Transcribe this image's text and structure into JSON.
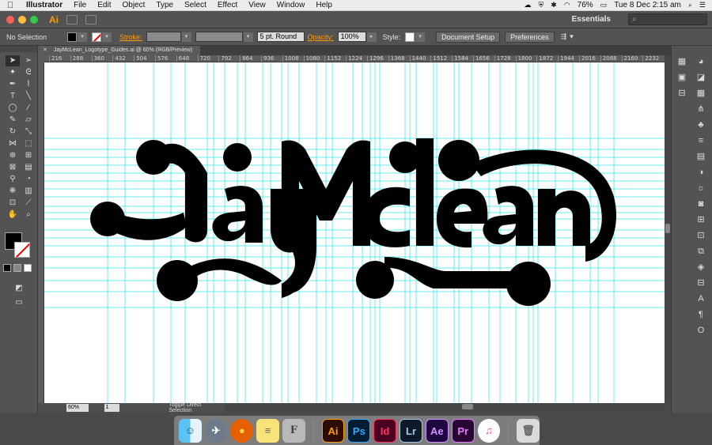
{
  "menubar": {
    "app_name": "Illustrator",
    "items": [
      "File",
      "Edit",
      "Object",
      "Type",
      "Select",
      "Effect",
      "View",
      "Window",
      "Help"
    ],
    "battery": "76%",
    "datetime": "Tue 8 Dec  2:15 am"
  },
  "appbar": {
    "logo": "Ai",
    "workspace": "Essentials"
  },
  "controlbar": {
    "selection": "No Selection",
    "stroke_label": "Stroke:",
    "brush": "5 pt. Round",
    "opacity_label": "Opacity:",
    "opacity_value": "100%",
    "style_label": "Style:",
    "document_setup": "Document Setup",
    "preferences": "Preferences"
  },
  "document": {
    "tab_title": "JayMcLean_Logotype_Guides.ai @ 60% (RGB/Preview)"
  },
  "ruler": {
    "marks": [
      "216",
      "288",
      "360",
      "432",
      "504",
      "576",
      "648",
      "720",
      "792",
      "864",
      "936",
      "1008",
      "1080",
      "1152",
      "1224",
      "1296",
      "1368",
      "1440",
      "1512",
      "1584",
      "1656",
      "1728",
      "1800",
      "1872",
      "1944",
      "2016",
      "2088",
      "2160",
      "2232"
    ]
  },
  "artwork": {
    "text": "JayMcLean",
    "fill": "#000000",
    "guide_color": "#34e3e8"
  },
  "statusbar": {
    "zoom": "60%",
    "page": "1",
    "status": "Toggle Direct Selection"
  },
  "dock": {
    "apps": [
      {
        "name": "Finder",
        "glyph": "☺",
        "cls": "finder"
      },
      {
        "name": "Launchpad",
        "glyph": "✈",
        "cls": "launch"
      },
      {
        "name": "Firefox",
        "glyph": "●",
        "cls": "firefox"
      },
      {
        "name": "Notes",
        "glyph": "≡",
        "cls": "notes"
      },
      {
        "name": "Font Book",
        "glyph": "F",
        "cls": "font"
      },
      {
        "name": "Illustrator",
        "glyph": "Ai",
        "cls": "ai"
      },
      {
        "name": "Photoshop",
        "glyph": "Ps",
        "cls": "ps"
      },
      {
        "name": "InDesign",
        "glyph": "Id",
        "cls": "id"
      },
      {
        "name": "Lightroom",
        "glyph": "Lr",
        "cls": "lr"
      },
      {
        "name": "After Effects",
        "glyph": "Ae",
        "cls": "ae"
      },
      {
        "name": "Premiere",
        "glyph": "Pr",
        "cls": "pr"
      },
      {
        "name": "iTunes",
        "glyph": "♫",
        "cls": "itunes"
      }
    ],
    "trash_glyph": "🗑"
  }
}
